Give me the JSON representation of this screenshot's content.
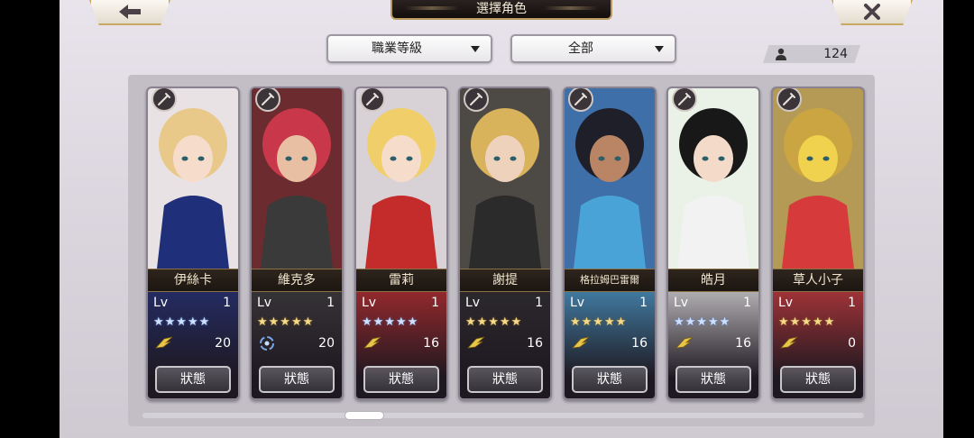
{
  "header": {
    "title": "選擇角色",
    "back_icon": "arrow-left-icon",
    "close_icon": "close-icon"
  },
  "filters": {
    "sort_label": "職業等級",
    "category_label": "全部"
  },
  "roster": {
    "count": "124",
    "icon": "person-icon"
  },
  "colors": {
    "gold_trim": "#c8a95f",
    "name_plate": "#1c1611",
    "blue_star": "#cfe0ff",
    "gold_star": "#f5d98a"
  },
  "characters": [
    {
      "name": "伊絲卡",
      "lv_label": "Lv",
      "lv": "1",
      "stars": "★★★★★",
      "star_color": "blue",
      "power": "20",
      "power_icon": "wing-icon",
      "role_icon": "sword-icon",
      "status": "狀態"
    },
    {
      "name": "維克多",
      "lv_label": "Lv",
      "lv": "1",
      "stars": "★★★★★",
      "star_color": "gold",
      "power": "20",
      "power_icon": "swirl-icon",
      "role_icon": "sword-icon",
      "status": "狀態"
    },
    {
      "name": "雷莉",
      "lv_label": "Lv",
      "lv": "1",
      "stars": "★★★★★",
      "star_color": "blue",
      "power": "16",
      "power_icon": "wing-icon",
      "role_icon": "axe-icon",
      "status": "狀態"
    },
    {
      "name": "謝提",
      "lv_label": "Lv",
      "lv": "1",
      "stars": "★★★★★",
      "star_color": "gold",
      "power": "16",
      "power_icon": "wing-icon",
      "role_icon": "spear-icon",
      "status": "狀態"
    },
    {
      "name": "格拉姆巴雷爾",
      "lv_label": "Lv",
      "lv": "1",
      "stars": "★★★★★",
      "star_color": "gold",
      "power": "16",
      "power_icon": "wing-icon",
      "role_icon": "spear-icon",
      "status": "狀態"
    },
    {
      "name": "皓月",
      "lv_label": "Lv",
      "lv": "1",
      "stars": "★★★★★",
      "star_color": "blue",
      "power": "16",
      "power_icon": "wing-icon",
      "role_icon": "bow-icon",
      "status": "狀態"
    },
    {
      "name": "草人小子",
      "lv_label": "Lv",
      "lv": "1",
      "stars": "★★★★★",
      "star_color": "gold",
      "power": "0",
      "power_icon": "wing-icon",
      "role_icon": "fist-icon",
      "status": "狀態"
    }
  ]
}
